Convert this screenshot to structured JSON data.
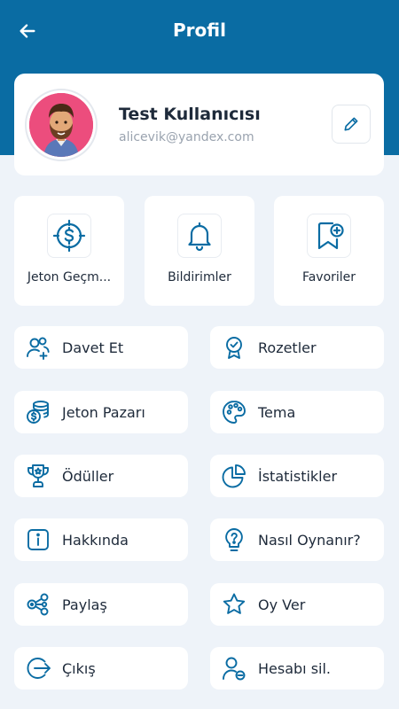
{
  "header": {
    "title": "Profil"
  },
  "profile": {
    "name": "Test Kullanıcısı",
    "email": "alicevik@yandex.com"
  },
  "quick_actions": [
    {
      "label": "Jeton Geçm...",
      "icon": "coin-history-icon"
    },
    {
      "label": "Bildirimler",
      "icon": "bell-icon"
    },
    {
      "label": "Favoriler",
      "icon": "bookmark-add-icon"
    }
  ],
  "menu": [
    {
      "label": "Davet Et",
      "icon": "invite-users-icon"
    },
    {
      "label": "Rozetler",
      "icon": "badge-icon"
    },
    {
      "label": "Jeton Pazarı",
      "icon": "coins-icon"
    },
    {
      "label": "Tema",
      "icon": "palette-icon"
    },
    {
      "label": "Ödüller",
      "icon": "trophy-icon"
    },
    {
      "label": "İstatistikler",
      "icon": "pie-chart-icon"
    },
    {
      "label": "Hakkında",
      "icon": "info-icon"
    },
    {
      "label": "Nasıl Oynanır?",
      "icon": "question-icon"
    },
    {
      "label": "Paylaş",
      "icon": "share-icon"
    },
    {
      "label": "Oy Ver",
      "icon": "star-icon"
    },
    {
      "label": "Çıkış",
      "icon": "logout-icon"
    },
    {
      "label": "Hesabı sil.",
      "icon": "delete-account-icon"
    }
  ],
  "colors": {
    "primary": "#0A6CA3",
    "background": "#EEF3F9",
    "avatar_bg": "#EC4D7D"
  }
}
